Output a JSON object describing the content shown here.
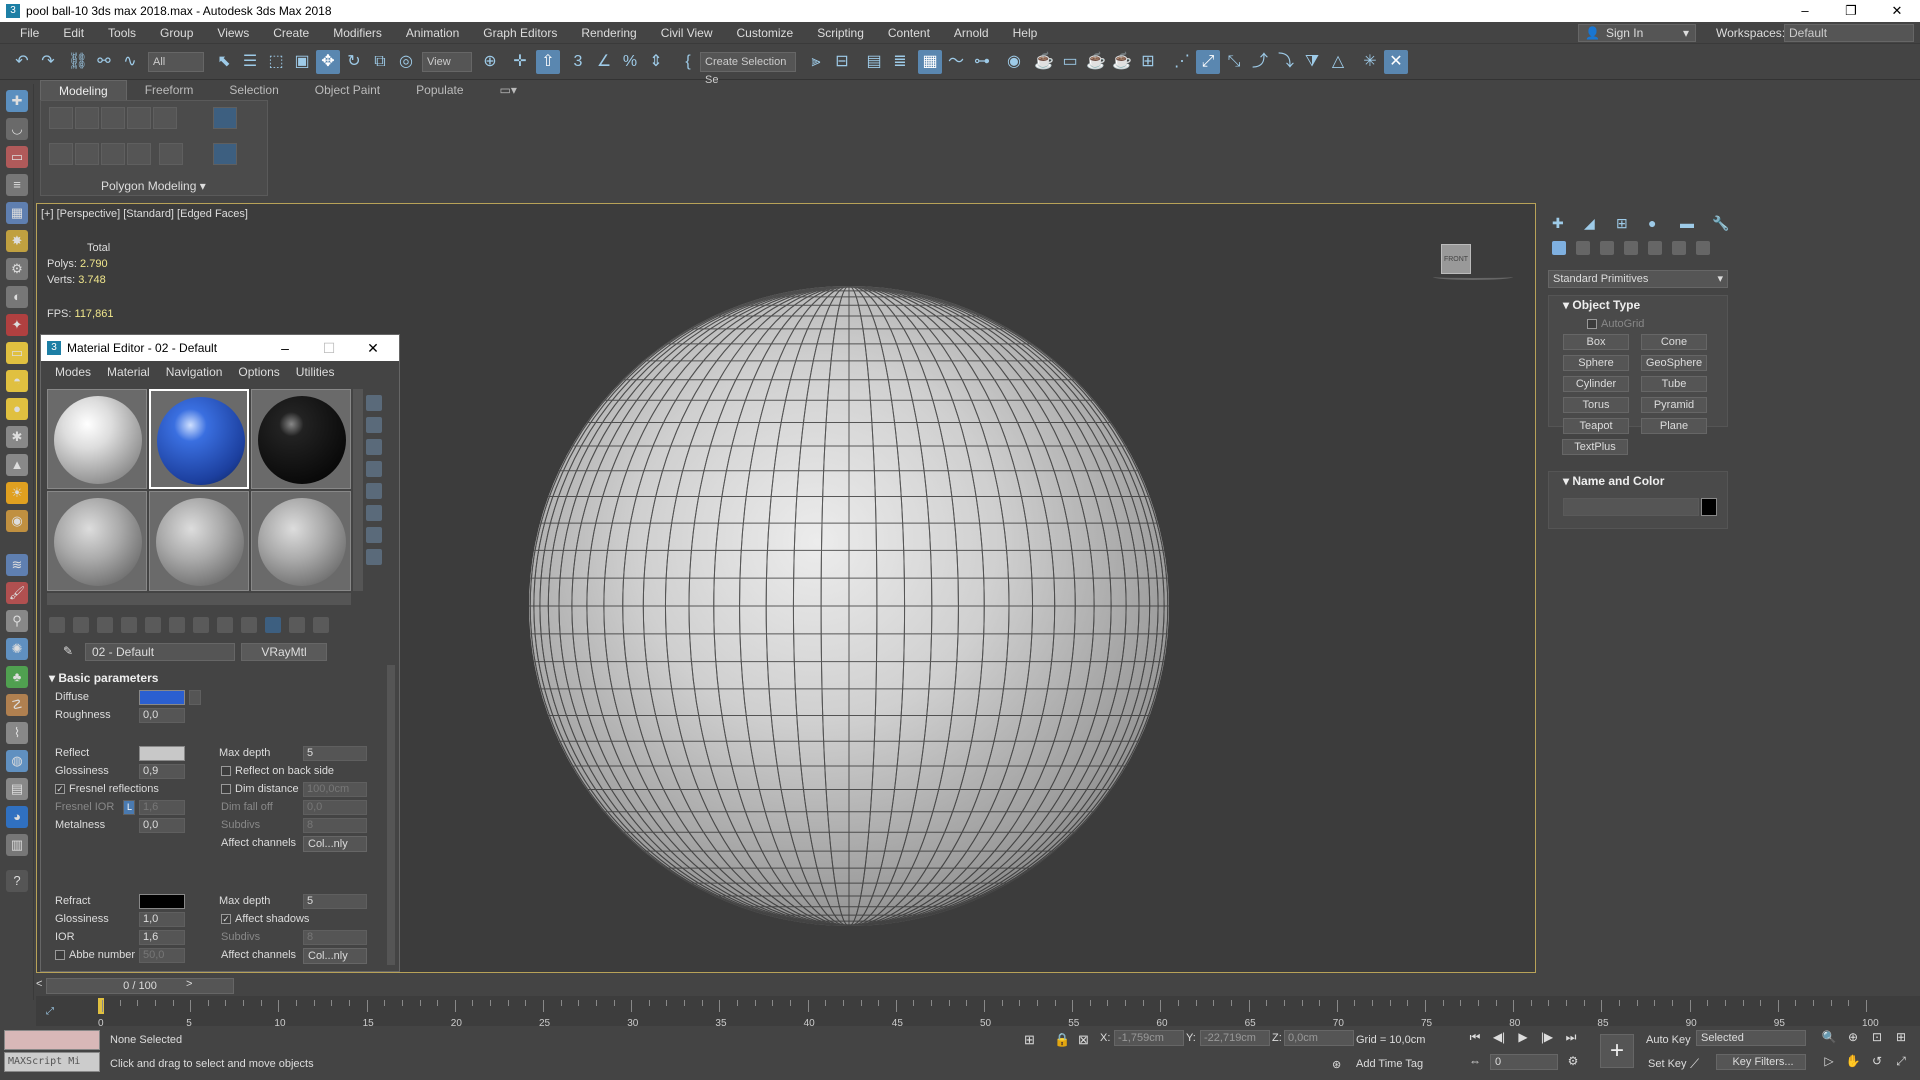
{
  "window": {
    "title": "pool ball-10 3ds max 2018.max - Autodesk 3ds Max 2018",
    "app_icon": "3"
  },
  "menubar": {
    "items": [
      "File",
      "Edit",
      "Tools",
      "Group",
      "Views",
      "Create",
      "Modifiers",
      "Animation",
      "Graph Editors",
      "Rendering",
      "Civil View",
      "Customize",
      "Scripting",
      "Content",
      "Arnold",
      "Help"
    ],
    "sign_in": "Sign In",
    "workspaces_label": "Workspaces:",
    "workspaces_value": "Default"
  },
  "toolbar": {
    "selection_filter": "All",
    "ref_coord": "View",
    "selection_set": "Create Selection Se"
  },
  "ribbon": {
    "tabs": [
      "Modeling",
      "Freeform",
      "Selection",
      "Object Paint",
      "Populate"
    ],
    "panel_label": "Polygon Modeling"
  },
  "viewport": {
    "label": "[+] [Perspective] [Standard] [Edged Faces]",
    "stats": {
      "total_label": "Total",
      "polys_label": "Polys:",
      "polys_value": "2.790",
      "verts_label": "Verts:",
      "verts_value": "3.748",
      "fps_label": "FPS:",
      "fps_value": "117,861"
    },
    "viewcube": "FRONT"
  },
  "material_editor": {
    "title": "Material Editor - 02 - Default",
    "icon": "3",
    "menu": [
      "Modes",
      "Material",
      "Navigation",
      "Options",
      "Utilities"
    ],
    "material_name": "02 - Default",
    "material_type": "VRayMtl",
    "section": "Basic parameters",
    "diffuse_label": "Diffuse",
    "diffuse_color": "#2b5fd0",
    "roughness_label": "Roughness",
    "roughness_value": "0,0",
    "reflect_label": "Reflect",
    "reflect_color": "#c8c8c8",
    "max_depth_label": "Max depth",
    "max_depth_value": "5",
    "glossiness_label": "Glossiness",
    "glossiness_value": "0,9",
    "reflect_back_label": "Reflect on back side",
    "fresnel_label": "Fresnel reflections",
    "dim_distance_label": "Dim distance",
    "dim_distance_value": "100,0cm",
    "fresnel_ior_label": "Fresnel IOR",
    "fresnel_ior_lock": "L",
    "fresnel_ior_value": "1,6",
    "dim_falloff_label": "Dim fall off",
    "dim_falloff_value": "0,0",
    "metalness_label": "Metalness",
    "metalness_value": "0,0",
    "subdivs_label": "Subdivs",
    "subdivs_value": "8",
    "affect_channels_label": "Affect channels",
    "affect_channels_value": "Col...nly",
    "refract_label": "Refract",
    "refract_color": "#000000",
    "refract_max_depth_value": "5",
    "refract_glossiness_value": "1,0",
    "affect_shadows_label": "Affect shadows",
    "ior_label": "IOR",
    "ior_value": "1,6",
    "refract_subdivs_value": "8",
    "abbe_label": "Abbe number",
    "abbe_value": "50,0",
    "refract_affect_channels_value": "Col...nly"
  },
  "command_panel": {
    "category": "Standard Primitives",
    "object_type_title": "Object Type",
    "autogrid_label": "AutoGrid",
    "buttons": [
      "Box",
      "Cone",
      "Sphere",
      "GeoSphere",
      "Cylinder",
      "Tube",
      "Torus",
      "Pyramid",
      "Teapot",
      "Plane",
      "TextPlus"
    ],
    "name_color_title": "Name and Color"
  },
  "timeline": {
    "slider": "0 / 100",
    "ticks": [
      "0",
      "5",
      "10",
      "15",
      "20",
      "25",
      "30",
      "35",
      "40",
      "45",
      "50",
      "55",
      "60",
      "65",
      "70",
      "75",
      "80",
      "85",
      "90",
      "95",
      "100"
    ]
  },
  "status": {
    "maxscript": "MAXScript Mi",
    "selection": "None Selected",
    "prompt": "Click and drag to select and move objects",
    "x_label": "X:",
    "x_value": "-1,759cm",
    "y_label": "Y:",
    "y_value": "-22,719cm",
    "z_label": "Z:",
    "z_value": "0,0cm",
    "grid": "Grid = 10,0cm",
    "add_time_tag": "Add Time Tag",
    "auto_key": "Auto Key",
    "auto_key_mode": "Selected",
    "set_key": "Set Key",
    "key_filters": "Key Filters...",
    "frame": "0"
  }
}
